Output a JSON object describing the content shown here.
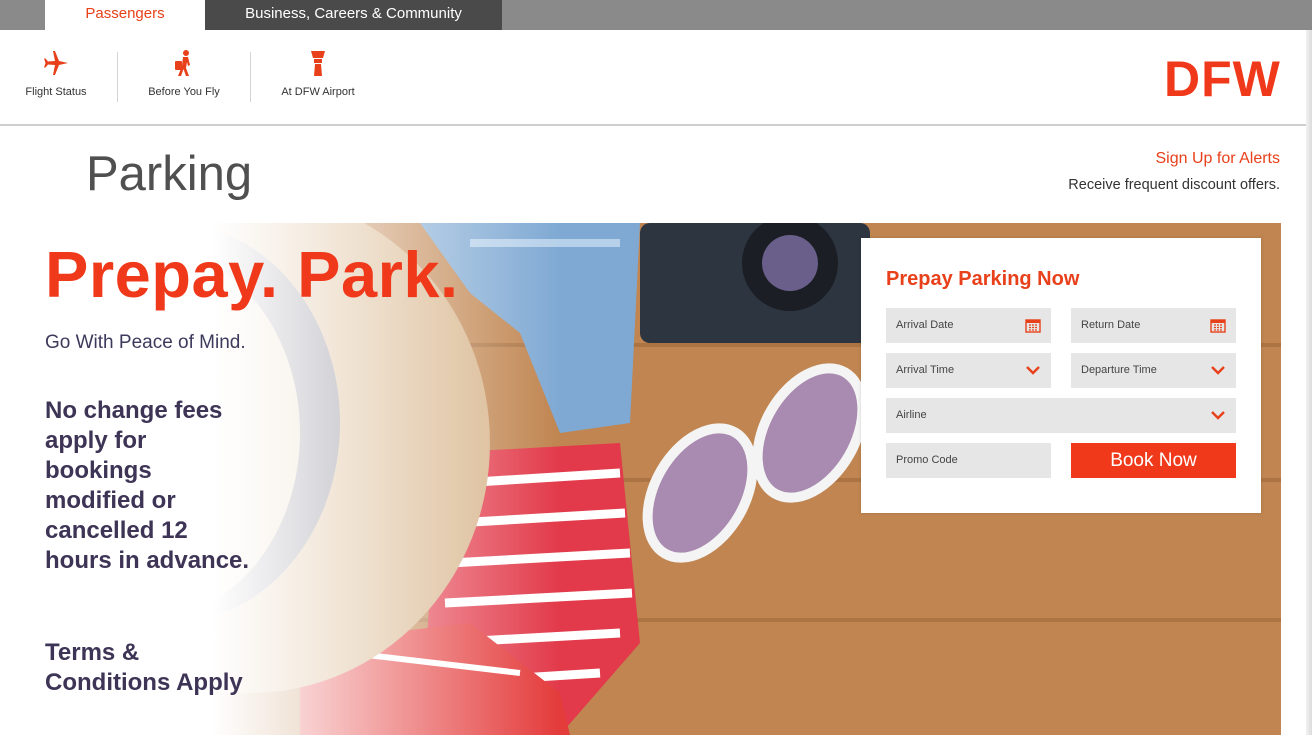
{
  "top_tabs": {
    "passengers": "Passengers",
    "business": "Business, Careers & Community"
  },
  "nav": {
    "flight_status": "Flight Status",
    "before_you_fly": "Before You Fly",
    "at_dfw": "At DFW Airport",
    "logo": "DFW"
  },
  "page": {
    "title": "Parking",
    "alerts_link": "Sign Up for Alerts",
    "alerts_sub": "Receive frequent discount offers."
  },
  "hero": {
    "headline": "Prepay. Park.",
    "subhead": "Go With Peace of Mind.",
    "fees": "No change fees apply for bookings modified or cancelled 12 hours in advance.",
    "terms": "Terms & Conditions Apply"
  },
  "form": {
    "title": "Prepay Parking Now",
    "arrival_date": "Arrival Date",
    "return_date": "Return Date",
    "arrival_time": "Arrival Time",
    "departure_time": "Departure Time",
    "airline": "Airline",
    "promo_code": "Promo Code",
    "book_now": "Book Now"
  },
  "icons": {
    "flight": "plane-icon",
    "before": "traveler-icon",
    "airport": "control-tower-icon",
    "calendar": "calendar-icon",
    "chevron": "chevron-down-icon"
  },
  "colors": {
    "accent": "#f0391a",
    "text_dark": "#3d3456",
    "topbar": "#8a8a8a",
    "topbar_dark": "#4a4a4a"
  }
}
